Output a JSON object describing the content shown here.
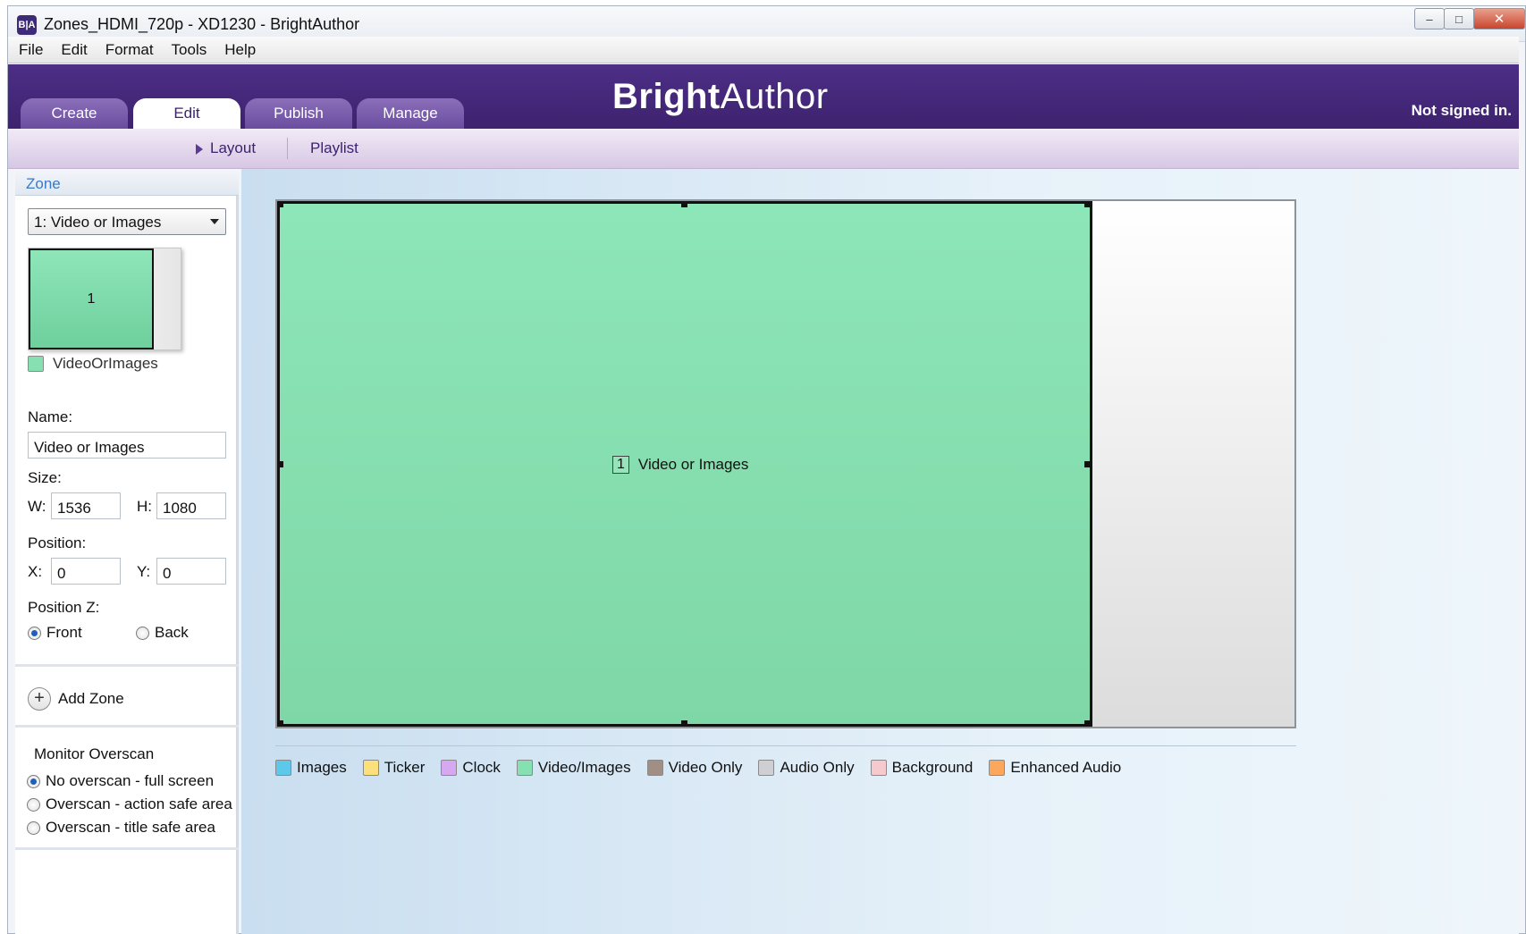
{
  "window": {
    "title": "Zones_HDMI_720p - XD1230 - BrightAuthor",
    "app_icon": "B|A"
  },
  "menu": [
    "File",
    "Edit",
    "Format",
    "Tools",
    "Help"
  ],
  "header": {
    "logo_bold": "Bright",
    "logo_light": "Author",
    "signed_in": "Not signed in.",
    "tabs": [
      {
        "label": "Create",
        "active": false
      },
      {
        "label": "Edit",
        "active": true
      },
      {
        "label": "Publish",
        "active": false
      },
      {
        "label": "Manage",
        "active": false
      }
    ]
  },
  "subnav": {
    "items": [
      {
        "label": "Layout",
        "active": true
      },
      {
        "label": "Playlist",
        "active": false
      }
    ]
  },
  "zone_panel": {
    "header": "Zone",
    "selected_zone": "1: Video or Images",
    "thumbnail_label": "1",
    "zone_type": "VideoOrImages",
    "name_label": "Name:",
    "name_value": "Video or Images",
    "size_label": "Size:",
    "w_label": "W:",
    "w_value": "1536",
    "h_label": "H:",
    "h_value": "1080",
    "position_label": "Position:",
    "x_label": "X:",
    "x_value": "0",
    "y_label": "Y:",
    "y_value": "0",
    "position_z_label": "Position Z:",
    "z_front": "Front",
    "z_back": "Back",
    "z_selected": "Front",
    "add_zone": "Add Zone",
    "overscan_title": "Monitor Overscan",
    "overscan_options": [
      "No overscan - full screen",
      "Overscan - action safe area",
      "Overscan - title safe area"
    ],
    "overscan_selected": "No overscan - full screen"
  },
  "canvas": {
    "zone_number": "1",
    "zone_name": "Video or Images"
  },
  "legend": [
    {
      "label": "Images",
      "color": "#5ec8ea"
    },
    {
      "label": "Ticker",
      "color": "#fbe07c"
    },
    {
      "label": "Clock",
      "color": "#d7a8f2"
    },
    {
      "label": "Video/Images",
      "color": "#86e0b2"
    },
    {
      "label": "Video Only",
      "color": "#a18f86"
    },
    {
      "label": "Audio Only",
      "color": "#cfcfd3"
    },
    {
      "label": "Background",
      "color": "#f6c9ce"
    },
    {
      "label": "Enhanced Audio",
      "color": "#fba85d"
    }
  ],
  "colors": {
    "header_purple": "#3e226f",
    "zone_green": "#86e0b2"
  }
}
